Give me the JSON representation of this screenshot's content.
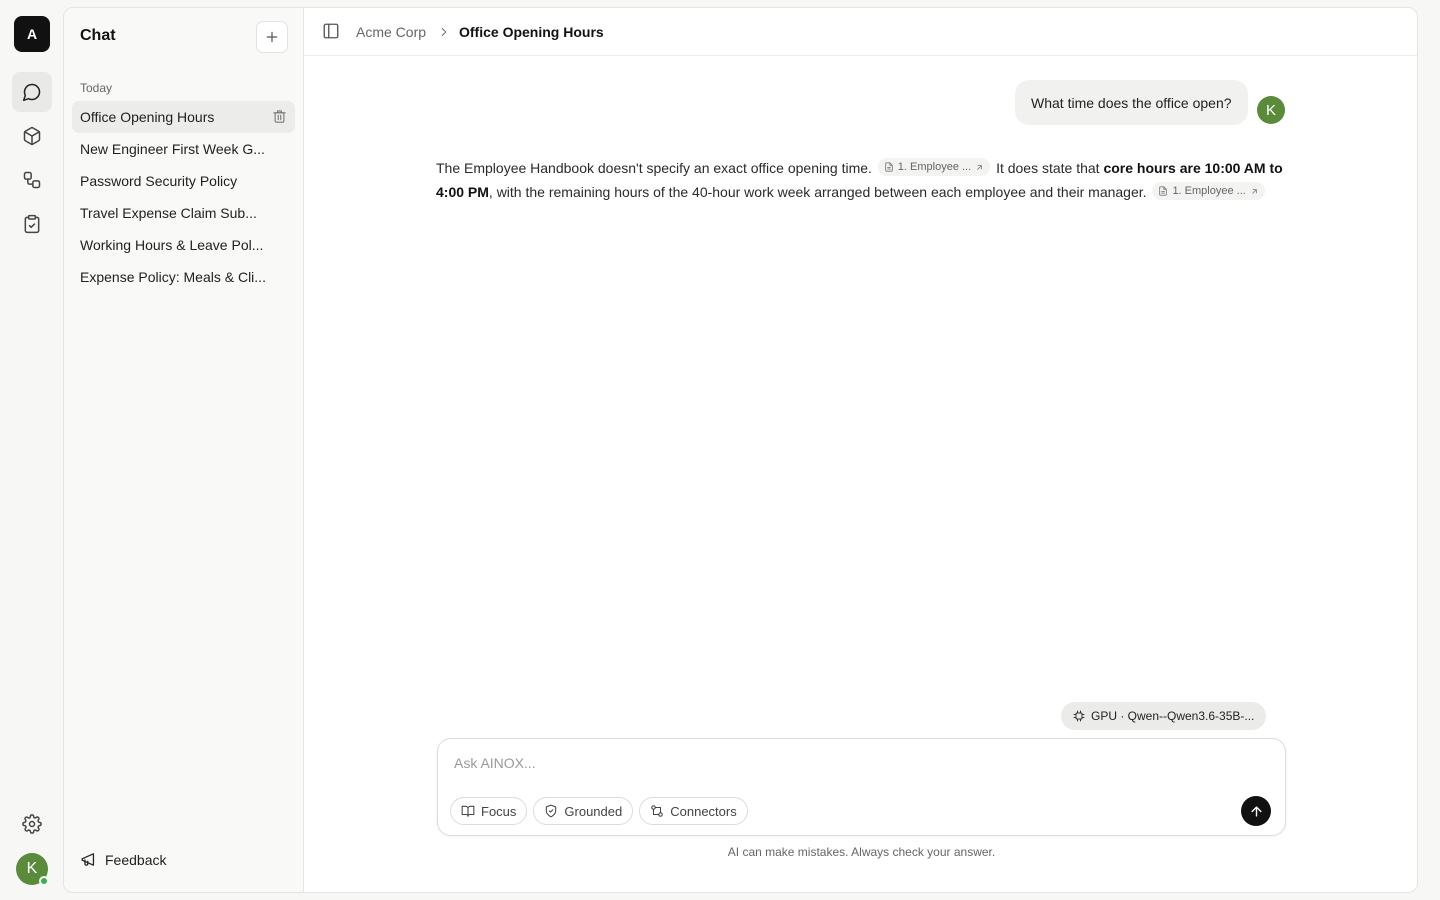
{
  "rail": {
    "logo": "A",
    "avatar": "K",
    "nav": [
      "chat-icon",
      "cube-icon",
      "workflow-icon",
      "clipboard-check-icon"
    ],
    "bottom": [
      "gear-icon"
    ]
  },
  "sidebar": {
    "title": "Chat",
    "section": "Today",
    "items": [
      {
        "label": "Office Opening Hours"
      },
      {
        "label": "New Engineer First Week G..."
      },
      {
        "label": "Password Security Policy"
      },
      {
        "label": "Travel Expense Claim Sub..."
      },
      {
        "label": "Working Hours & Leave Pol..."
      },
      {
        "label": "Expense Policy: Meals & Cli..."
      }
    ],
    "feedback": "Feedback"
  },
  "header": {
    "crumb_root": "Acme Corp",
    "crumb_current": "Office Opening Hours"
  },
  "conversation": {
    "user_message": "What time does the office open?",
    "user_avatar": "K",
    "answer": {
      "part1": "The Employee Handbook doesn't specify an exact office opening time.",
      "cite1": "1. Employee ...",
      "part2": "It does state that",
      "bold": "core hours are 10:00 AM to 4:00 PM",
      "part3": ", with the remaining hours of the 40-hour work week arranged between each employee and their manager.",
      "cite2": "1. Employee ..."
    }
  },
  "composer": {
    "model": "GPU · Qwen--Qwen3.6-35B-...",
    "placeholder": "Ask AINOX...",
    "tools": [
      "Focus",
      "Grounded",
      "Connectors"
    ],
    "disclaimer": "AI can make mistakes. Always check your answer."
  }
}
